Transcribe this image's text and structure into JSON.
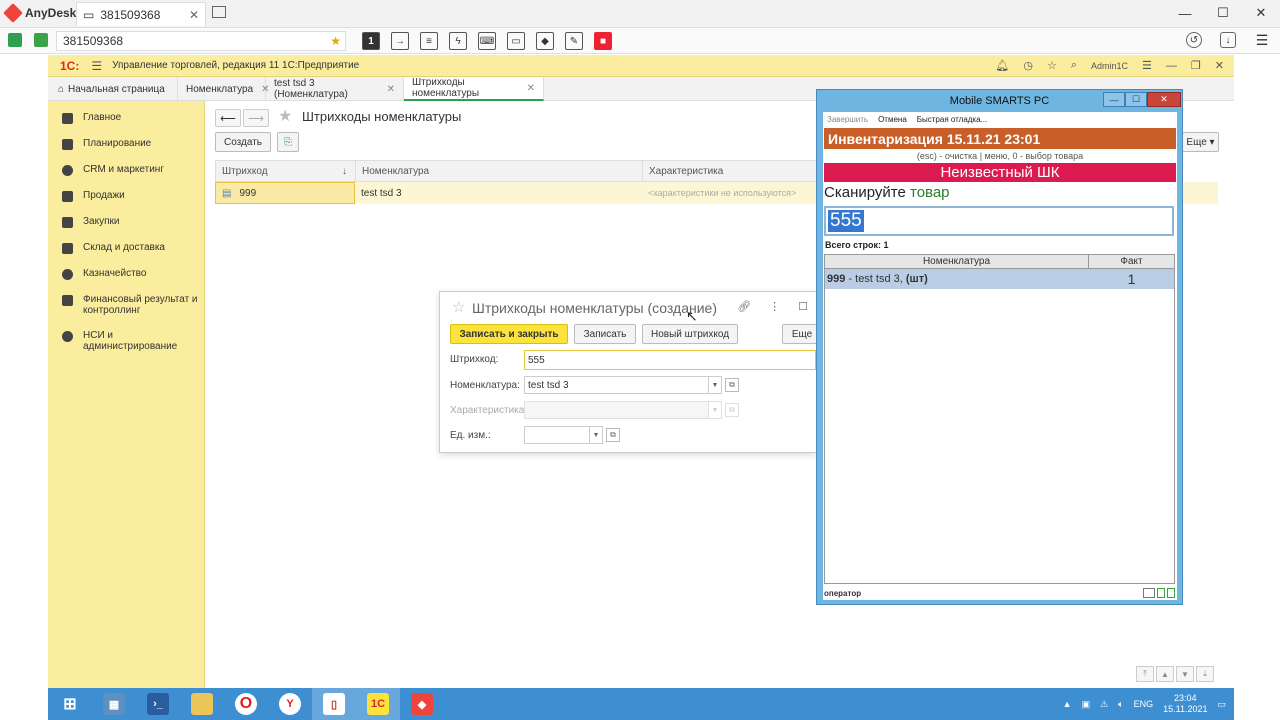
{
  "anydesk": {
    "app_name": "AnyDesk",
    "tab_label": "381509368",
    "address": "381509368",
    "session_badge": "1"
  },
  "onec": {
    "logo": "1С:",
    "app_title": "Управление торговлей, редакция 11 1С:Предприятие",
    "user": "Admin1C",
    "tabs": [
      {
        "label": "Начальная страница"
      },
      {
        "label": "Номенклатура"
      },
      {
        "label": "test tsd 3 (Номенклатура)"
      },
      {
        "label": "Штрихкоды номенклатуры"
      }
    ],
    "sidebar": [
      {
        "label": "Главное"
      },
      {
        "label": "Планирование"
      },
      {
        "label": "CRM и маркетинг"
      },
      {
        "label": "Продажи"
      },
      {
        "label": "Закупки"
      },
      {
        "label": "Склад и доставка"
      },
      {
        "label": "Казначейство"
      },
      {
        "label": "Финансовый результат и контроллинг"
      },
      {
        "label": "НСИ и администрирование"
      }
    ],
    "page_title": "Штрихкоды номенклатуры",
    "create_button": "Создать",
    "more_button": "Еще",
    "grid": {
      "columns": [
        "Штрихкод",
        "Номенклатура",
        "Характеристика"
      ],
      "rows": [
        {
          "barcode": "999",
          "item": "test tsd 3",
          "characteristic": "<характеристики не используются>"
        }
      ]
    },
    "dialog": {
      "title": "Штрихкоды номенклатуры (создание)",
      "save_close": "Записать и закрыть",
      "save": "Записать",
      "new_barcode": "Новый штрихкод",
      "more": "Еще",
      "barcode_label": "Штрихкод:",
      "barcode_value": "555",
      "item_label": "Номенклатура:",
      "item_value": "test tsd 3",
      "char_label": "Характеристика:",
      "unit_label": "Ед. изм.:"
    }
  },
  "mobile_smarts": {
    "title": "Mobile SMARTS PC",
    "menu": [
      "Завершить",
      "Отмена",
      "Быстрая отладка..."
    ],
    "header": "Инвентаризация 15.11.21 23:01",
    "hint": "(esc) - очистка | меню, 0 - выбор товара",
    "alert": "Неизвестный ШК",
    "scan_prefix": "Сканируйте",
    "scan_word": "товар",
    "input_value": "555",
    "total": "Всего строк: 1",
    "columns": [
      "Номенклатура",
      "Факт"
    ],
    "rows": [
      {
        "code": "999",
        "name": " - test tsd 3, ",
        "unit": "(шт)",
        "fact": "1"
      }
    ],
    "status": "оператор"
  },
  "taskbar": {
    "lang": "ENG",
    "time": "23:04",
    "date": "15.11.2021",
    "onec_label": "1С"
  },
  "colors": {
    "onec_yellow": "#fbed9e",
    "button_yellow": "#fbe33b",
    "ms_orange": "#c85f28",
    "ms_red": "#db1b4f",
    "taskbar_blue": "#3d8fd2"
  }
}
